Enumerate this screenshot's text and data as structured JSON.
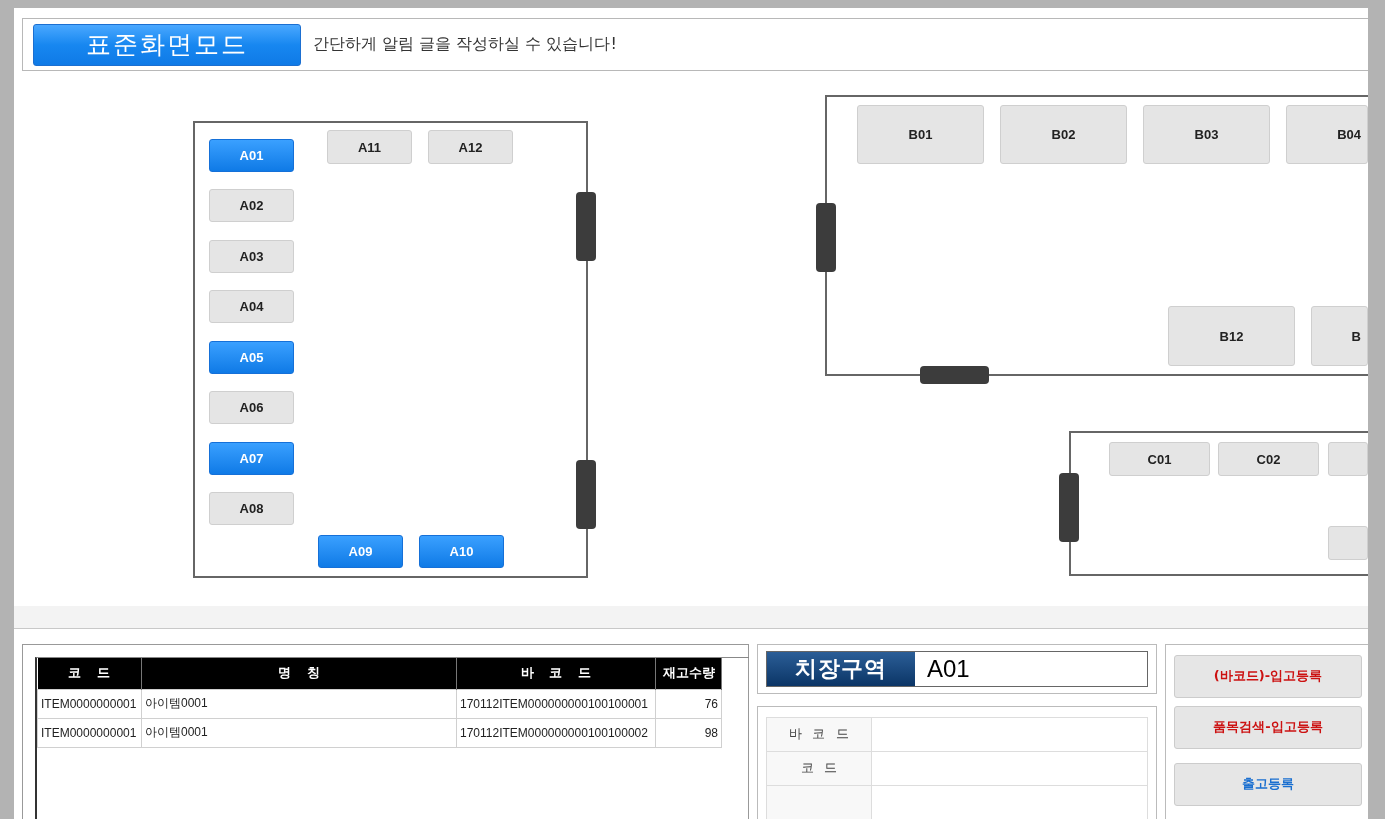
{
  "header": {
    "mode_button": "표준화면모드",
    "notice": "간단하게 알림 글을 작성하실 수 있습니다!"
  },
  "zones": [
    {
      "slots": [
        {
          "label": "A01",
          "selected": true
        },
        {
          "label": "A02",
          "selected": false
        },
        {
          "label": "A03",
          "selected": false
        },
        {
          "label": "A04",
          "selected": false
        },
        {
          "label": "A05",
          "selected": true
        },
        {
          "label": "A06",
          "selected": false
        },
        {
          "label": "A07",
          "selected": true
        },
        {
          "label": "A08",
          "selected": false
        },
        {
          "label": "A09",
          "selected": true
        },
        {
          "label": "A10",
          "selected": true
        },
        {
          "label": "A11",
          "selected": false
        },
        {
          "label": "A12",
          "selected": false
        }
      ]
    },
    {
      "slots": [
        {
          "label": "B01",
          "selected": false
        },
        {
          "label": "B02",
          "selected": false
        },
        {
          "label": "B03",
          "selected": false
        },
        {
          "label": "B04",
          "selected": false
        },
        {
          "label": "B12",
          "selected": false
        },
        {
          "label": "B",
          "selected": false
        }
      ]
    },
    {
      "slots": [
        {
          "label": "C01",
          "selected": false
        },
        {
          "label": "C02",
          "selected": false
        },
        {
          "selected": false
        },
        {
          "selected": false
        }
      ]
    }
  ],
  "stock_table": {
    "columns": [
      "코 드",
      "명 칭",
      "바 코 드",
      "재고수량"
    ],
    "rows": [
      [
        "ITEM0000000001",
        "아이템0001",
        "170112ITEM000000000100100001",
        "76"
      ],
      [
        "ITEM0000000001",
        "아이템0001",
        "170112ITEM000000000100100002",
        "98"
      ]
    ]
  },
  "storage_area": {
    "label": "치장구역",
    "value": "A01"
  },
  "detail_fields": [
    {
      "label": "바 코 드"
    },
    {
      "label": "코 드"
    }
  ],
  "actions": [
    {
      "label": "(바코드)-입고등록",
      "color": "#cc1111"
    },
    {
      "label": "품목검색-입고등록",
      "color": "#cc1111"
    },
    {
      "label": "출고등록",
      "color": "#1a6fd0"
    }
  ]
}
